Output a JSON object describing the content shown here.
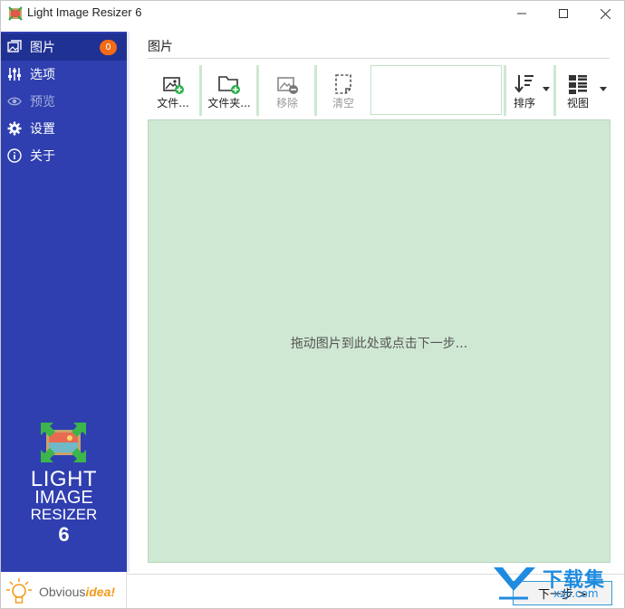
{
  "window": {
    "title": "Light Image Resizer 6"
  },
  "sidebar": {
    "items": [
      {
        "label": "图片",
        "icon": "images-icon",
        "badge": "0",
        "active": true
      },
      {
        "label": "选项",
        "icon": "sliders-icon"
      },
      {
        "label": "预览",
        "icon": "eye-icon",
        "disabled": true
      },
      {
        "label": "设置",
        "icon": "gear-icon"
      },
      {
        "label": "关于",
        "icon": "info-icon"
      }
    ],
    "brand": {
      "line1": "LIGHT",
      "line2": "IMAGE",
      "line3": "RESIZER",
      "version": "6"
    },
    "background": "#2f3fb0",
    "active_background": "#203194",
    "badge_color": "#f26b17"
  },
  "footer": {
    "company_prefix": "Obvious",
    "company_accent": "idea!",
    "next_label": "下一步 >"
  },
  "main": {
    "section_title": "图片",
    "toolbar": {
      "add_files_label": "文件...",
      "add_folder_label": "文件夹...",
      "remove_label": "移除",
      "clear_label": "清空",
      "sort_label": "排序",
      "view_label": "视图"
    },
    "dropzone_text": "拖动图片到此处或点击下一步...",
    "dropzone_color": "#cfe8d3"
  },
  "watermark": {
    "text": "下载集",
    "sub": "xzji.com"
  }
}
